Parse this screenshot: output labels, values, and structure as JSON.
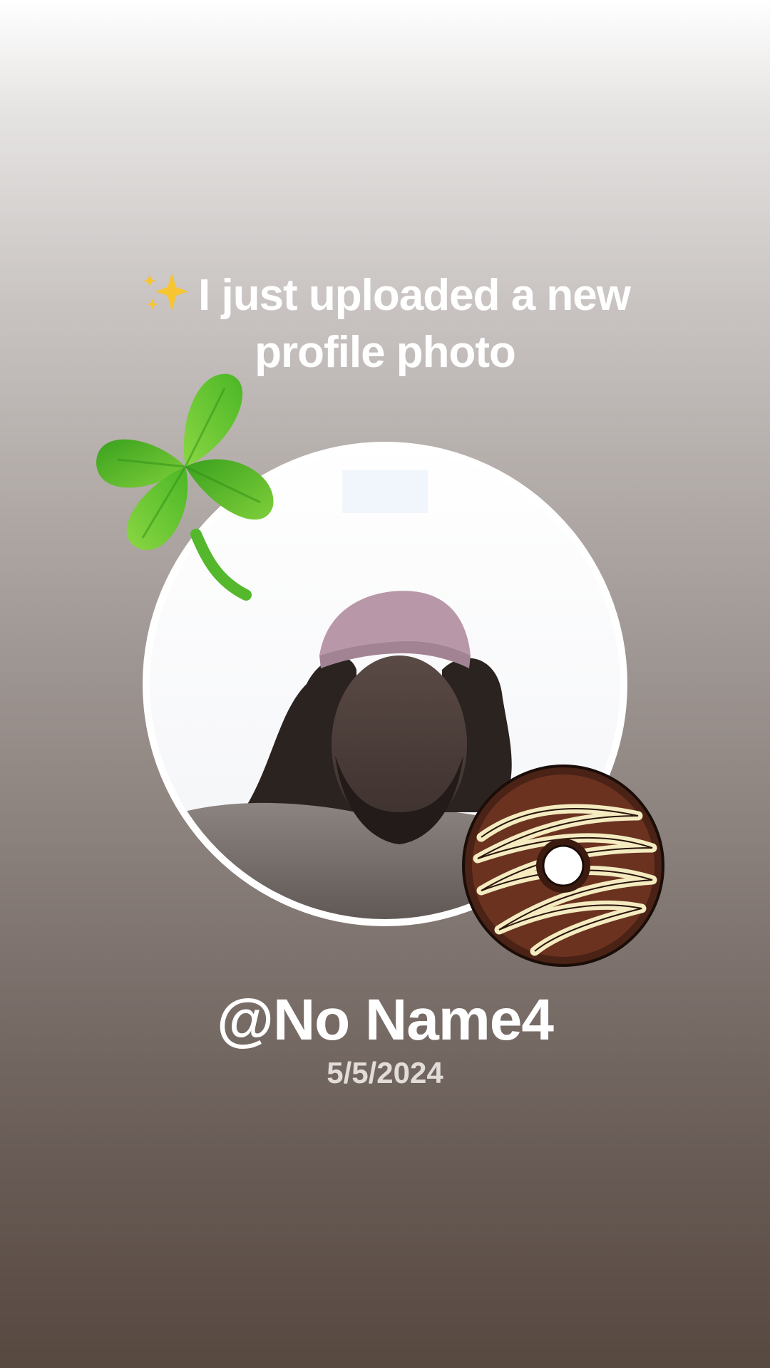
{
  "post": {
    "headline": "I just uploaded a new profile photo",
    "username": "@No Name4",
    "date": "5/5/2024"
  },
  "stickers": {
    "sparkle": "sparkles-icon",
    "clover": "four-leaf-clover-icon",
    "donut": "chocolate-donut-icon"
  },
  "colors": {
    "text": "#ffffff",
    "date": "#e2dcd8",
    "gradient_top": "#ffffff",
    "gradient_bottom": "#574840"
  }
}
